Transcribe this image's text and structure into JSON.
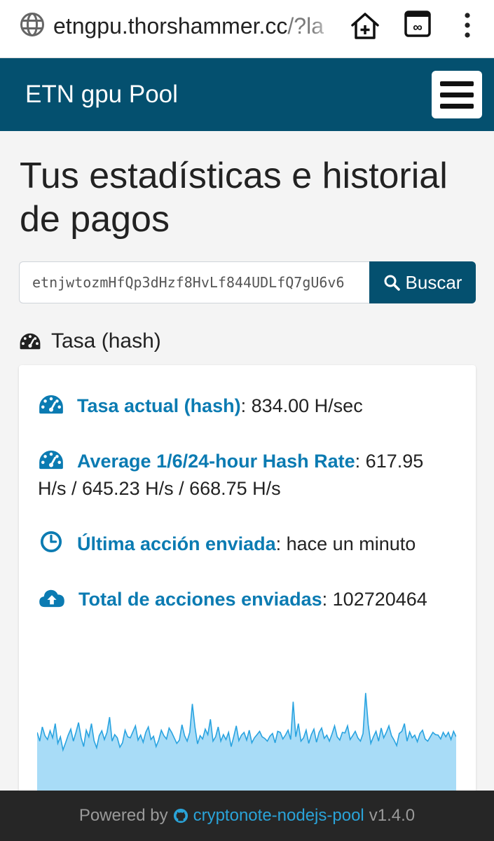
{
  "browser": {
    "url_host": "etngpu.thorshammer.cc",
    "url_rest": "/?la"
  },
  "navbar": {
    "brand": "ETN gpu Pool"
  },
  "page": {
    "title": "Tus estadísticas e historial de pagos",
    "search": {
      "value": "etnjwtozmHfQp3dHzf8HvLf844UDLfQ7gU6v6",
      "button_label": "Buscar"
    }
  },
  "hashrate_section": {
    "heading": "Tasa (hash)",
    "stats": [
      {
        "icon": "tachometer-icon",
        "label": "Tasa actual (hash)",
        "value": "834.00 H/sec"
      },
      {
        "icon": "tachometer-icon",
        "label": "Average 1/6/24-hour Hash Rate",
        "value": "617.95 H/s / 645.23 H/s / 668.75 H/s"
      },
      {
        "icon": "clock-icon",
        "label": "Última acción enviada",
        "value": "hace un minuto"
      },
      {
        "icon": "cloud-upload-icon",
        "label": "Total de acciones enviadas",
        "value": "102720464"
      }
    ]
  },
  "chart_data": {
    "type": "area",
    "title": "",
    "xlabel": "",
    "ylabel": "",
    "grid": false,
    "color": "#29a3e0",
    "fill": "#a8dcf7",
    "values": [
      640,
      560,
      690,
      610,
      575,
      655,
      590,
      720,
      540,
      600,
      480,
      545,
      615,
      670,
      560,
      640,
      730,
      590,
      510,
      660,
      600,
      720,
      565,
      500,
      610,
      655,
      575,
      640,
      780,
      560,
      620,
      590,
      505,
      545,
      660,
      600,
      590,
      645,
      700,
      570,
      615,
      550,
      640,
      690,
      575,
      605,
      510,
      570,
      660,
      610,
      580,
      680,
      640,
      590,
      540,
      570,
      710,
      610,
      560,
      640,
      900,
      690,
      535,
      610,
      580,
      670,
      620,
      760,
      560,
      600,
      690,
      560,
      620,
      575,
      640,
      510,
      600,
      700,
      565,
      615,
      640,
      570,
      660,
      545,
      590,
      620,
      650,
      600,
      585,
      560,
      605,
      630,
      545,
      650,
      640,
      580,
      615,
      660,
      575,
      920,
      600,
      720,
      560,
      590,
      660,
      540,
      620,
      670,
      550,
      640,
      680,
      585,
      615,
      560,
      625,
      700,
      600,
      570,
      640,
      635,
      700,
      575,
      610,
      650,
      590,
      560,
      630,
      1000,
      710,
      540,
      600,
      650,
      560,
      680,
      590,
      640,
      700,
      610,
      570,
      520,
      630,
      650,
      720,
      560,
      645,
      590,
      615,
      555,
      630,
      660,
      580,
      560,
      600,
      640,
      620,
      615,
      580,
      640,
      600,
      640,
      575,
      650,
      600
    ]
  },
  "footer": {
    "prefix": "Powered by",
    "link": "cryptonote-nodejs-pool",
    "version": "v1.4.0"
  }
}
